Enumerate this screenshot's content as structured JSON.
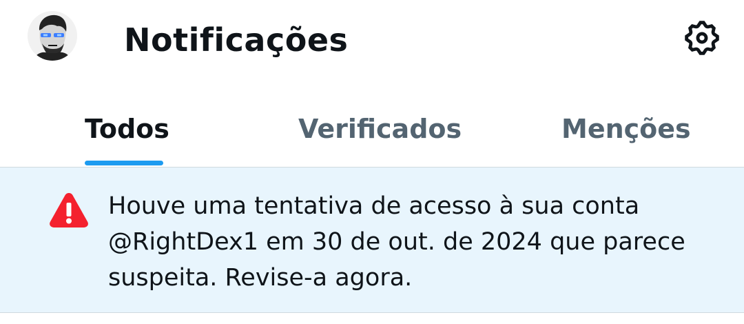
{
  "header": {
    "title": "Notificações",
    "avatar_icon": "user-avatar",
    "settings_icon": "gear-icon"
  },
  "tabs": [
    {
      "label": "Todos",
      "active": true
    },
    {
      "label": "Verificados",
      "active": false
    },
    {
      "label": "Menções",
      "active": false
    }
  ],
  "alert": {
    "icon": "warning-triangle-icon",
    "lines": [
      "Houve uma tentativa de acesso à sua conta",
      "@RightDex1 em 30 de out. de 2024 que parece",
      "suspeita. Revise-a agora."
    ]
  },
  "colors": {
    "accent": "#1d9bf0",
    "alert_background": "#e8f5fd",
    "warning": "#f4212e",
    "inactive_tab": "#536471",
    "text": "#0f1419"
  }
}
